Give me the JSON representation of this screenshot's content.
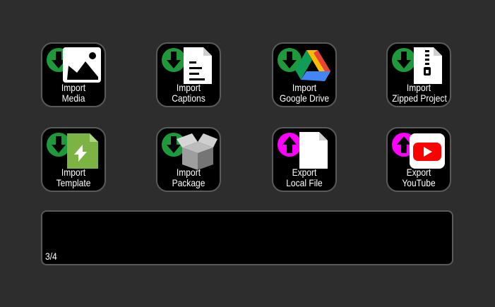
{
  "colors": {
    "background": "#2d2d2d",
    "tile": "#000000",
    "tile_border": "#5a5a5a",
    "import_arrow": "#1e9a3c",
    "export_arrow": "#ff00ff"
  },
  "tiles": [
    {
      "line1": "Import",
      "line2": "Media",
      "icon": "image-icon",
      "arrow": "download-arrow-icon"
    },
    {
      "line1": "Import",
      "line2": "Captions",
      "icon": "document-icon",
      "arrow": "download-arrow-icon"
    },
    {
      "line1": "Import",
      "line2": "Google Drive",
      "icon": "google-drive-icon",
      "arrow": "download-arrow-icon"
    },
    {
      "line1": "Import",
      "line2": "Zipped Project",
      "icon": "zip-file-icon",
      "arrow": "download-arrow-icon"
    },
    {
      "line1": "Import",
      "line2": "Template",
      "icon": "template-icon",
      "arrow": "download-arrow-icon"
    },
    {
      "line1": "Import",
      "line2": "Package",
      "icon": "package-box-icon",
      "arrow": "download-arrow-icon"
    },
    {
      "line1": "Export",
      "line2": "Local File",
      "icon": "blank-file-icon",
      "arrow": "upload-arrow-icon"
    },
    {
      "line1": "Export",
      "line2": "YouTube",
      "icon": "youtube-icon",
      "arrow": "upload-arrow-icon"
    }
  ],
  "status": {
    "page_indicator": "3/4"
  }
}
